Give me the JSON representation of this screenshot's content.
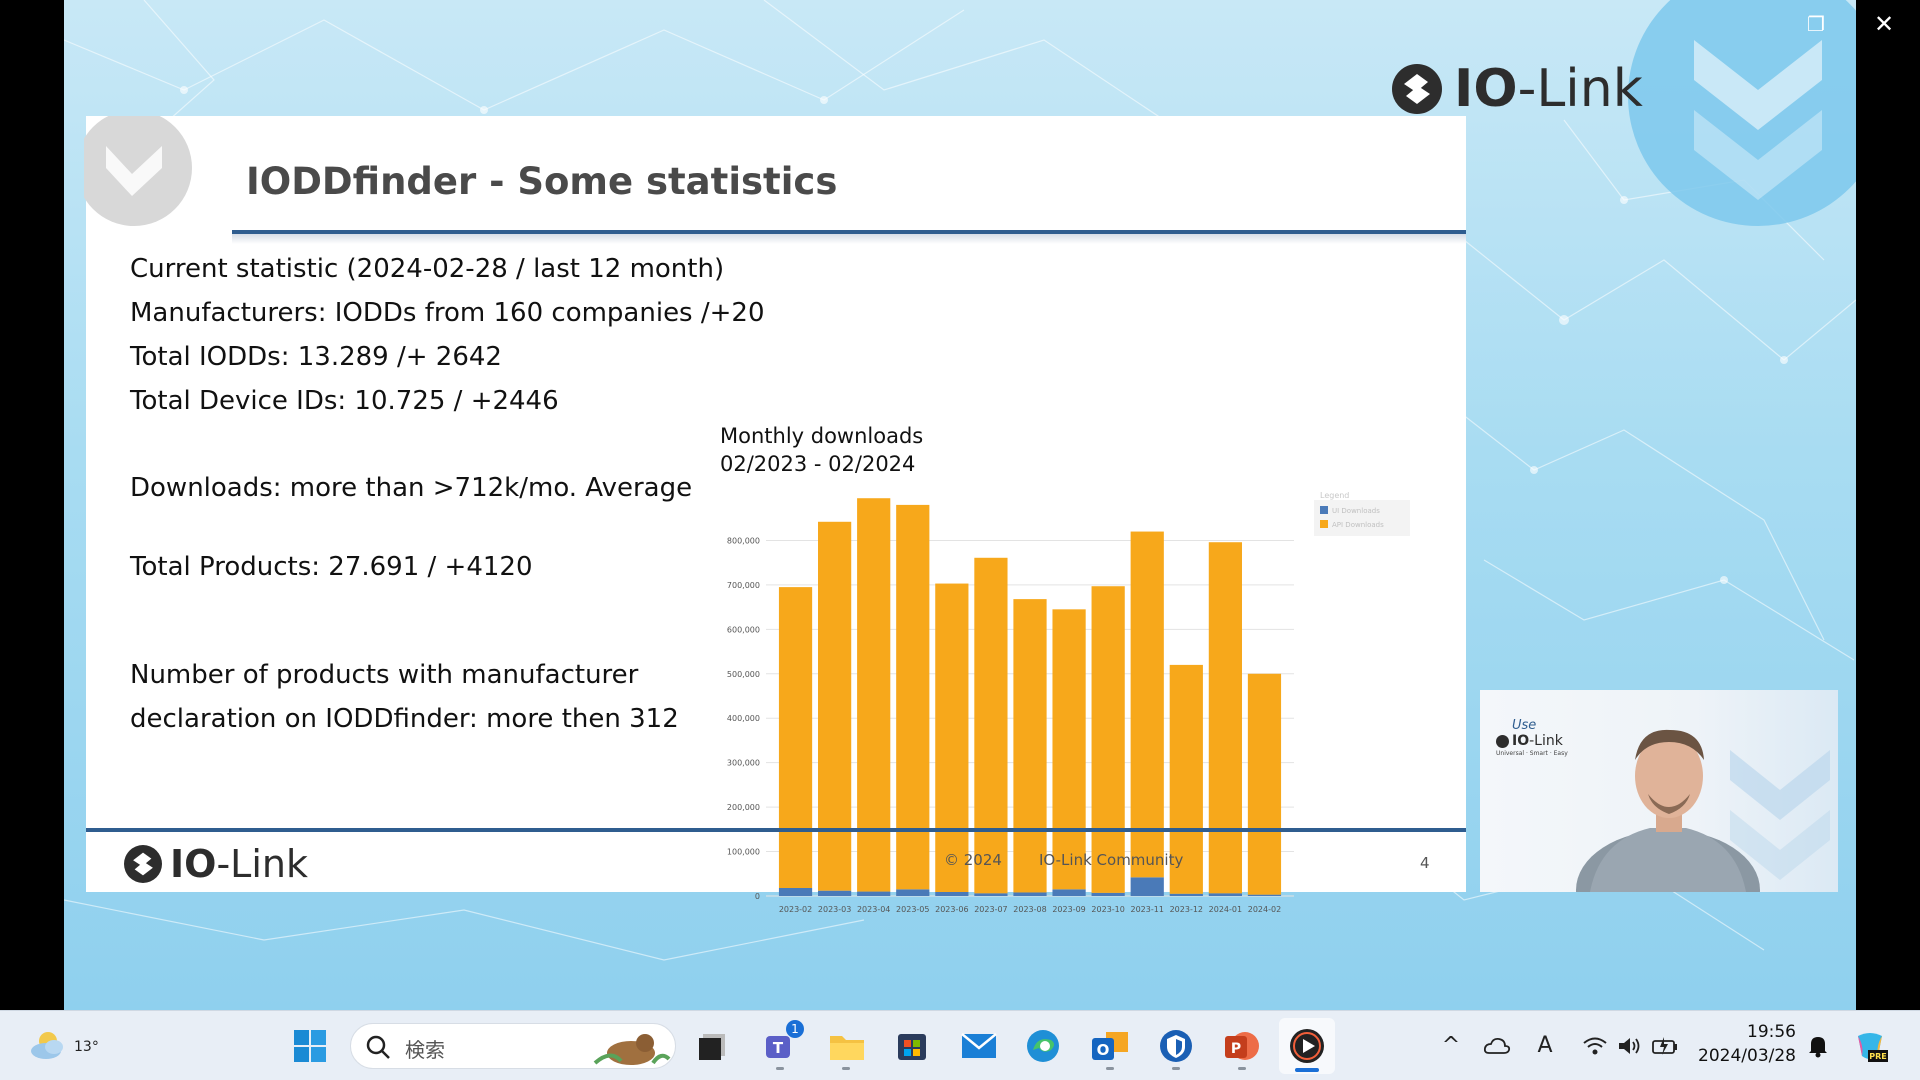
{
  "window": {
    "restore_glyph": "❐",
    "close_glyph": "✕"
  },
  "brand": {
    "bold": "IO",
    "rest": "-Link"
  },
  "slide": {
    "title": "IODDfinder - Some statistics",
    "stats": [
      "Current statistic (2024-02-28  / last 12 month)",
      "Manufacturers: IODDs from 160 companies  /+20",
      "Total IODDs: 13.289 /+ 2642",
      "Total Device IDs: 10.725 / +2446",
      "Downloads: more than >712k/mo. Average",
      "Total Products: 27.691 / +4120",
      "Number of products with manufacturer",
      "declaration on IODDfinder: more then 312"
    ],
    "chart_title_line1": "Monthly downloads",
    "chart_title_line2": "02/2023 - 02/2024",
    "footer_copyright": "© 2024",
    "footer_community": "IO-Link Community",
    "page_number": "4"
  },
  "chart_data": {
    "type": "bar",
    "stacked": true,
    "categories": [
      "2023-02",
      "2023-03",
      "2023-04",
      "2023-05",
      "2023-06",
      "2023-07",
      "2023-08",
      "2023-09",
      "2023-10",
      "2023-11",
      "2023-12",
      "2024-01",
      "2024-02"
    ],
    "series": [
      {
        "name": "UI Downloads",
        "color": "#4a7ab8",
        "values": [
          18000,
          12000,
          10000,
          15000,
          9000,
          6000,
          8000,
          15000,
          7000,
          42000,
          5000,
          6000,
          3000
        ]
      },
      {
        "name": "API Downloads",
        "color": "#f7a81b",
        "values": [
          677000,
          830000,
          885000,
          865000,
          694000,
          755000,
          660000,
          630000,
          690000,
          778000,
          515000,
          790000,
          497000
        ]
      }
    ],
    "yticks": [
      0,
      100000,
      200000,
      300000,
      400000,
      500000,
      600000,
      700000,
      800000
    ],
    "ytick_labels": [
      "0",
      "100,000",
      "200,000",
      "300,000",
      "400,000",
      "500,000",
      "600,000",
      "700,000",
      "800,000"
    ],
    "ylim": [
      0,
      900000
    ],
    "legend_title": "Legend",
    "legend_position": "right",
    "grid": true
  },
  "webcam": {
    "use_text": "Use",
    "tagline": "Universal · Smart · Easy"
  },
  "taskbar": {
    "weather_temp": "13°",
    "search_placeholder": "検索",
    "teams_badge": "1",
    "clock_time": "19:56",
    "clock_date": "2024/03/28",
    "ime_glyph": "A",
    "chevron_glyph": "^"
  }
}
